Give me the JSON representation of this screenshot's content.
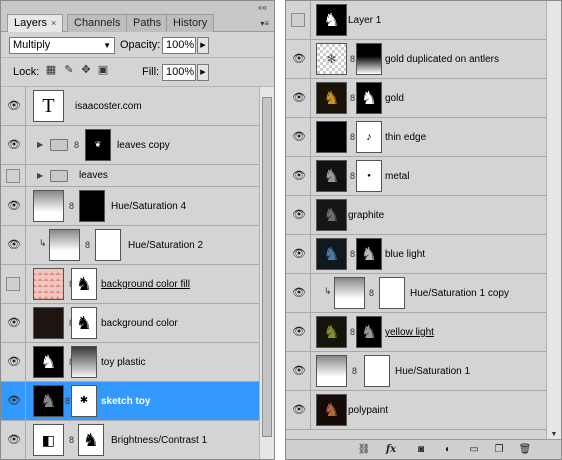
{
  "left_panel": {
    "tabs": [
      "Layers",
      "Channels",
      "Paths",
      "History"
    ],
    "tab_close": "×",
    "collapse": "««",
    "menu": "▾≡",
    "blend_mode": "Multiply",
    "opacity_label": "Opacity:",
    "opacity_value": "100%",
    "lock_label": "Lock:",
    "fill_label": "Fill:",
    "fill_value": "100%",
    "layers": [
      {
        "name": "isaacoster.com"
      },
      {
        "name": "leaves copy"
      },
      {
        "name": "leaves"
      },
      {
        "name": "Hue/Saturation 4"
      },
      {
        "name": "Hue/Saturation 2"
      },
      {
        "name": "background color fill"
      },
      {
        "name": "background color"
      },
      {
        "name": "toy plastic"
      },
      {
        "name": "sketch toy"
      },
      {
        "name": "Brightness/Contrast 1"
      }
    ]
  },
  "right_panel": {
    "layers": [
      {
        "name": "Layer 1"
      },
      {
        "name": "gold duplicated on antlers"
      },
      {
        "name": "gold"
      },
      {
        "name": "thin edge"
      },
      {
        "name": "metal"
      },
      {
        "name": "graphite"
      },
      {
        "name": "blue light"
      },
      {
        "name": "Hue/Saturation 1 copy"
      },
      {
        "name": "yellow light"
      },
      {
        "name": "Hue/Saturation 1"
      },
      {
        "name": "polypaint"
      }
    ],
    "toolbar_icons": [
      "link-icon",
      "fx-icon",
      "mask-icon",
      "adjustment-icon",
      "folder-icon",
      "new-layer-icon",
      "trash-icon"
    ]
  },
  "colors": {
    "panel_bg": "#d4d4d4",
    "selected": "#3399ff"
  }
}
